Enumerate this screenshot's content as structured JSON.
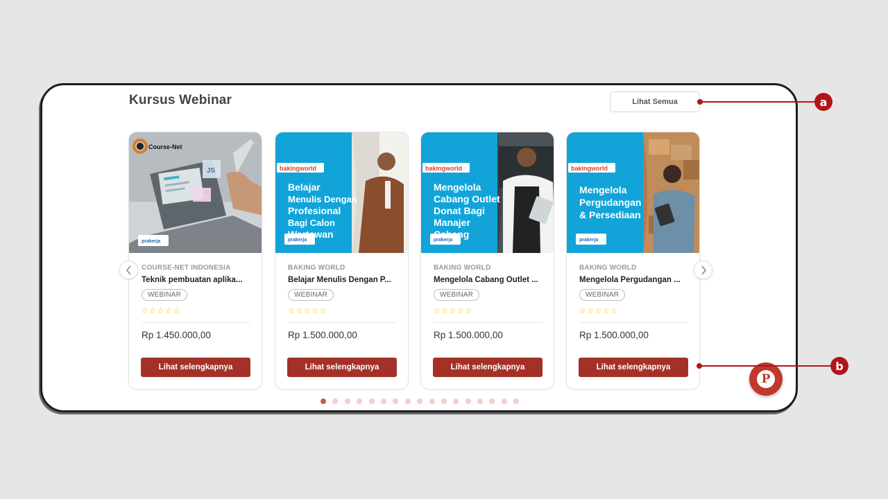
{
  "section": {
    "title": "Kursus Webinar",
    "see_all_label": "Lihat Semua"
  },
  "cards": [
    {
      "provider": "COURSE-NET INDONESIA",
      "title": "Teknik pembuatan aplika...",
      "badge": "WEBINAR",
      "price": "Rp 1.450.000,00",
      "cta": "Lihat selengkapnya",
      "rating": 0,
      "thumb": {
        "brand": "Course-Net",
        "headline": [],
        "partner": "prakerja"
      }
    },
    {
      "provider": "BAKING WORLD",
      "title": "Belajar Menulis Dengan P...",
      "badge": "WEBINAR",
      "price": "Rp 1.500.000,00",
      "cta": "Lihat selengkapnya",
      "rating": 0,
      "thumb": {
        "brand": "bakingworld",
        "headline": [
          "Belajar",
          "Menulis Dengan",
          "Profesional",
          "Bagi Calon",
          "Wartawan"
        ],
        "partner": "prakerja"
      }
    },
    {
      "provider": "BAKING WORLD",
      "title": "Mengelola Cabang Outlet ...",
      "badge": "WEBINAR",
      "price": "Rp 1.500.000,00",
      "cta": "Lihat selengkapnya",
      "rating": 0,
      "thumb": {
        "brand": "bakingworld",
        "headline": [
          "Mengelola",
          "Cabang Outlet",
          "Donat Bagi",
          "Manajer",
          "Cabang"
        ],
        "partner": "prakerja"
      }
    },
    {
      "provider": "BAKING WORLD",
      "title": "Mengelola Pergudangan ...",
      "badge": "WEBINAR",
      "price": "Rp 1.500.000,00",
      "cta": "Lihat selengkapnya",
      "rating": 0,
      "thumb": {
        "brand": "bakingworld",
        "headline": [
          "Mengelola",
          "Pergudangan",
          "& Persediaan"
        ],
        "partner": "prakerja"
      }
    }
  ],
  "carousel": {
    "page_count": 17,
    "active_index": 0,
    "prev_icon": "chevron-left-icon",
    "next_icon": "chevron-right-icon"
  },
  "fab": {
    "glyph": "P",
    "icon": "prakerja-chat-icon"
  },
  "callouts": [
    {
      "label": "a"
    },
    {
      "label": "b"
    }
  ],
  "colors": {
    "accent": "#a33128",
    "callout": "#b3141a",
    "thumb_blue": "#12a4d9",
    "star": "#f0b400"
  }
}
